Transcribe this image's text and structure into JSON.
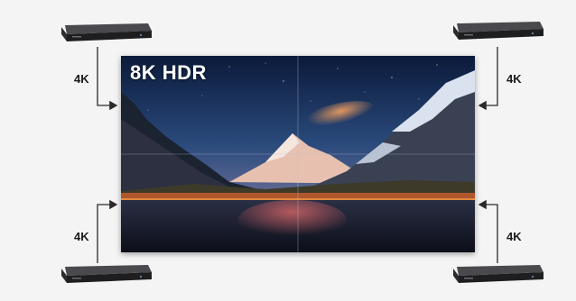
{
  "wall": {
    "label": "8K HDR"
  },
  "sources": [
    {
      "id": "top-left",
      "label": "4K"
    },
    {
      "id": "top-right",
      "label": "4K"
    },
    {
      "id": "bottom-left",
      "label": "4K"
    },
    {
      "id": "bottom-right",
      "label": "4K"
    }
  ],
  "colors": {
    "background": "#f4f4f4",
    "wire": "#2a2a2a",
    "device": "#1e1e20"
  }
}
